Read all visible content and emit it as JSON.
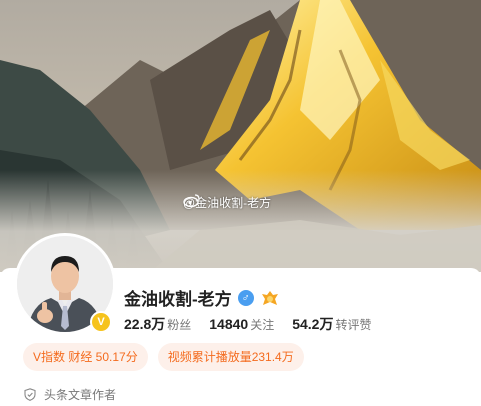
{
  "cover": {
    "watermark_text": "@金油收割-老方",
    "watermark_icon": "weibo-icon"
  },
  "profile": {
    "name": "金油收割-老方",
    "avatar_icon": "user-avatar",
    "verified_badge": "V",
    "gender_icon": "male-icon",
    "level_icon": "level-badge-icon",
    "stats": [
      {
        "value": "22.8万",
        "label": "粉丝"
      },
      {
        "value": "14840",
        "label": "关注"
      },
      {
        "value": "54.2万",
        "label": "转评赞"
      }
    ],
    "tags": [
      {
        "label": "V指数 财经 50.17分"
      },
      {
        "label": "视频累计播放量231.4万"
      }
    ],
    "certification": {
      "icon": "shield-icon",
      "text": "头条文章作者"
    }
  },
  "colors": {
    "tag_bg": "#fdf0ea",
    "tag_text": "#f46b1e",
    "verified_yellow": "#f6c31d",
    "gender_blue": "#4a9ef0"
  }
}
